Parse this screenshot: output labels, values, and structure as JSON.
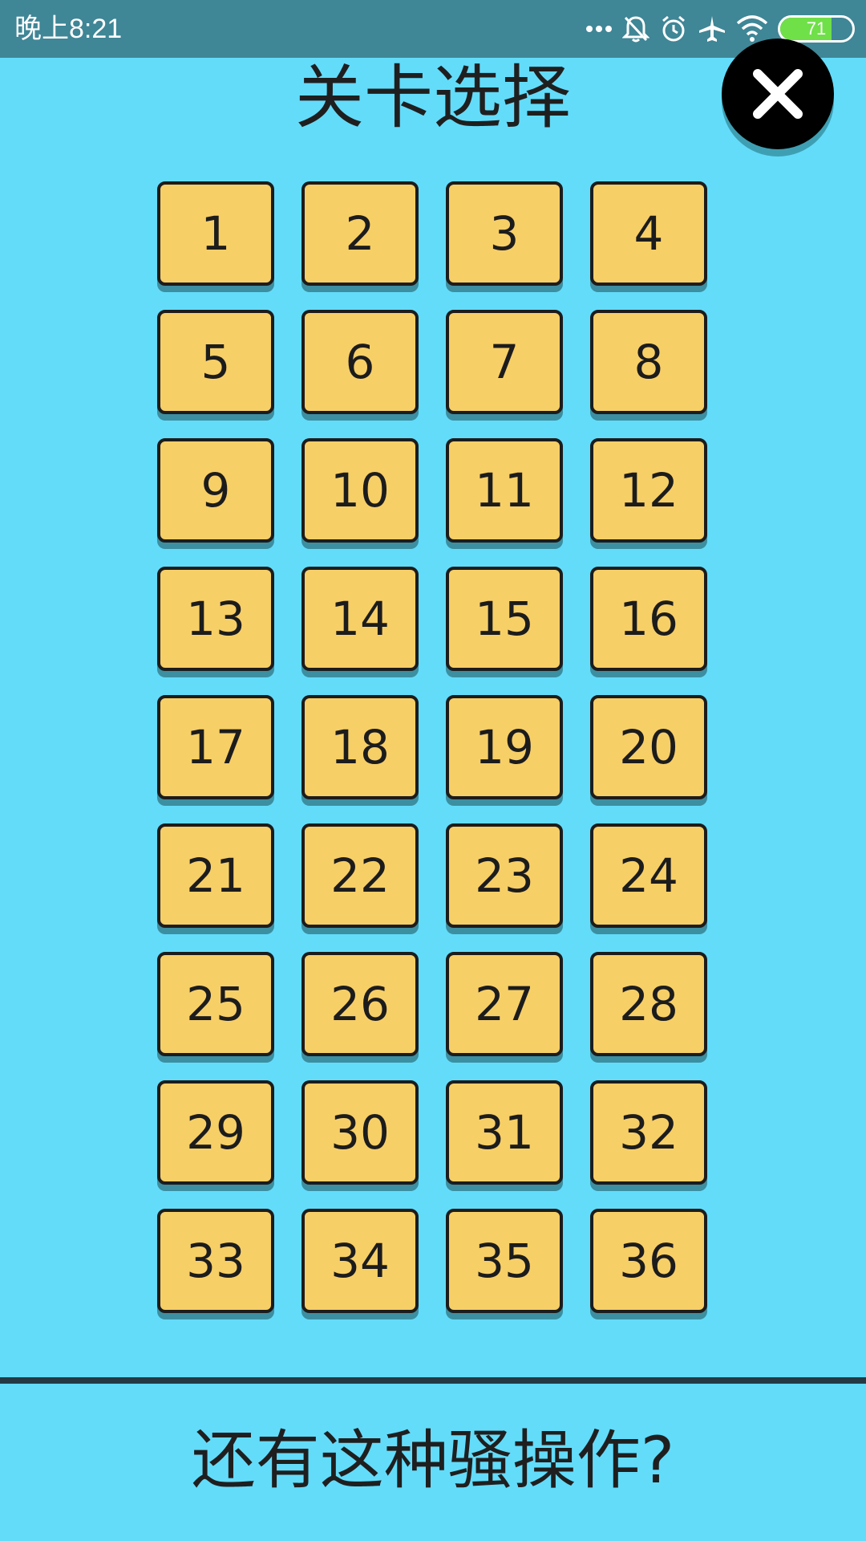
{
  "status_bar": {
    "time": "晚上8:21",
    "battery_level": "71",
    "icons": [
      "more-dots-icon",
      "mute-bell-icon",
      "alarm-icon",
      "airplane-icon",
      "wifi-icon",
      "battery-icon"
    ]
  },
  "header": {
    "title": "关卡选择",
    "close_icon": "close-icon"
  },
  "levels": [
    "1",
    "2",
    "3",
    "4",
    "5",
    "6",
    "7",
    "8",
    "9",
    "10",
    "11",
    "12",
    "13",
    "14",
    "15",
    "16",
    "17",
    "18",
    "19",
    "20",
    "21",
    "22",
    "23",
    "24",
    "25",
    "26",
    "27",
    "28",
    "29",
    "30",
    "31",
    "32",
    "33",
    "34",
    "35",
    "36"
  ],
  "footer": {
    "text": "还有这种骚操作?"
  },
  "colors": {
    "background": "#63dcfa",
    "status_bar": "#3f8696",
    "level_button": "#f7cf67",
    "close_button": "#000000",
    "battery_fill": "#6fe048"
  }
}
